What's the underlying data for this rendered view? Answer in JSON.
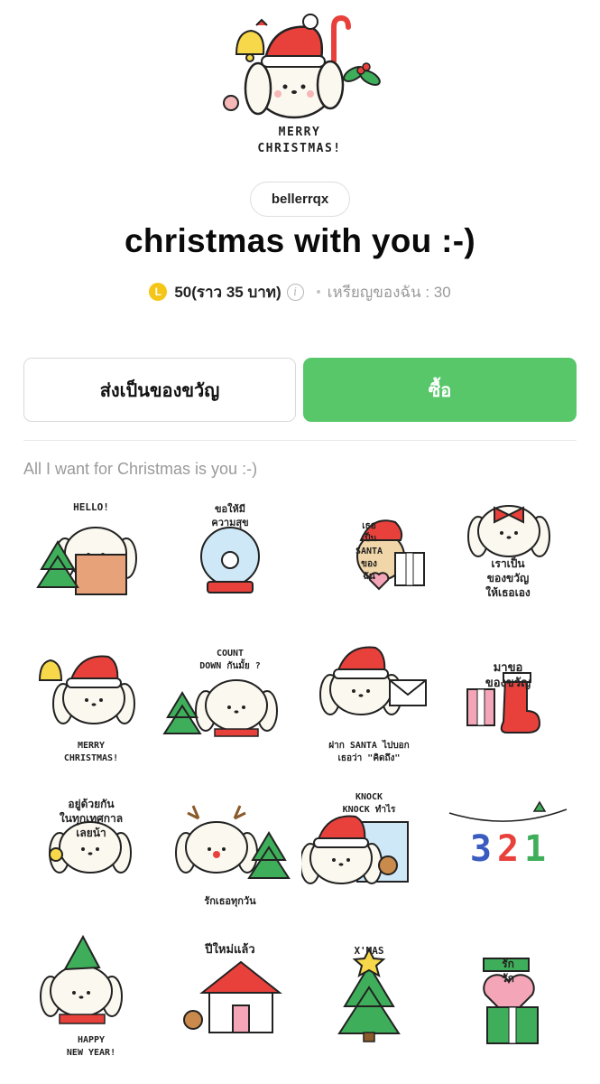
{
  "hero": {
    "lettering_line1": "MERRY",
    "lettering_line2": "CHRISTMAS!"
  },
  "author": {
    "name": "bellerrqx"
  },
  "pack": {
    "title": "christmas with you :-)",
    "description": "All I want for Christmas is you :-)"
  },
  "price": {
    "coin_symbol": "L",
    "amount": "50(ราว 35 บาท)",
    "my_coins": "เหรียญของฉัน : 30"
  },
  "actions": {
    "gift_label": "ส่งเป็นของขวัญ",
    "buy_label": "ซื้อ"
  },
  "colors": {
    "buy_green": "#57c76a",
    "coin_yellow": "#f5c518",
    "santa_red": "#e8413c",
    "tree_green": "#3fae5a"
  },
  "stickers": [
    {
      "name": "hello",
      "lines": [
        "HELLO!"
      ]
    },
    {
      "name": "snowglobe",
      "lines": [
        "ขอให้มี",
        "ความสุข"
      ]
    },
    {
      "name": "santa-bear",
      "lines": [
        "เธอ",
        "เป็น",
        "SANTA",
        "ของ",
        "ฉัน"
      ]
    },
    {
      "name": "gift-bow",
      "lines": [
        "เราเป็น",
        "ของขวัญ",
        "ให้เธอเอง"
      ]
    },
    {
      "name": "merry-christmas",
      "lines": [
        "MERRY",
        "CHRISTMAS!"
      ]
    },
    {
      "name": "countdown",
      "lines": [
        "COUNT",
        "DOWN กันมั้ย ?"
      ]
    },
    {
      "name": "santa-letter",
      "lines": [
        "ฝาก SANTA ไปบอก",
        "เธอว่า \"คิดถึง\""
      ]
    },
    {
      "name": "stocking",
      "lines": [
        "มาขอ",
        "ของขวัญ"
      ]
    },
    {
      "name": "together",
      "lines": [
        "อยู่ด้วยกัน",
        "ในทุกเทศกาล",
        "เลยน้า"
      ]
    },
    {
      "name": "reindeer",
      "lines": [
        "รักเธอทุกวัน"
      ]
    },
    {
      "name": "knock-knock",
      "lines": [
        "KNOCK",
        "KNOCK ทำไร"
      ]
    },
    {
      "name": "three-two-one",
      "lines": [
        "3",
        "2",
        "1"
      ]
    },
    {
      "name": "happy-new-year",
      "lines": [
        "HAPPY",
        "NEW YEAR!"
      ]
    },
    {
      "name": "new-year-house",
      "lines": [
        "ปีใหม่แล้ว"
      ]
    },
    {
      "name": "xmas-tree",
      "lines": [
        "X'MAS"
      ]
    },
    {
      "name": "love-gift",
      "lines": [
        "รัก",
        "รัก"
      ]
    }
  ]
}
